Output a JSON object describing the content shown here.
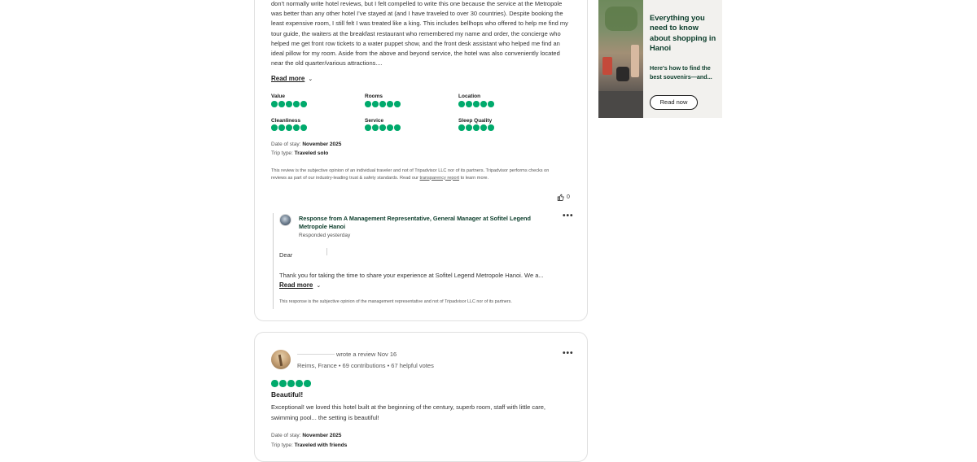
{
  "review1": {
    "body": "don’t normally write hotel reviews, but I felt compelled to write this one because the service at the Metropole was better than any other hotel I’ve stayed at (and I have traveled to over 30 countries). Despite booking the least expensive room, I still felt I was treated like a king. This includes bellhops who offered to help me find my tour guide, the waiters at the breakfast restaurant who remembered my name and order, the concierge who helped me get front row tickets to a water puppet show, and the front desk assistant who helped me find an ideal pillow for my room. Aside from the above and beyond service, the hotel was also conveniently located near the old quarter/various attractions....",
    "read_more": "Read more",
    "ratings": [
      {
        "label": "Value",
        "score": 5
      },
      {
        "label": "Rooms",
        "score": 5
      },
      {
        "label": "Location",
        "score": 5
      },
      {
        "label": "Cleanliness",
        "score": 5
      },
      {
        "label": "Service",
        "score": 5
      },
      {
        "label": "Sleep Quality",
        "score": 5
      }
    ],
    "date_label": "Date of stay:",
    "date_value": "November 2025",
    "trip_label": "Trip type:",
    "trip_value": "Traveled solo",
    "disclaimer_pre": "This review is the subjective opinion of an individual traveler and not of Tripadvisor LLC nor of its partners. Tripadvisor performs checks on reviews as part of our industry-leading trust & safety standards. Read our ",
    "disclaimer_link": "transparency report",
    "disclaimer_post": " to learn more.",
    "helpful_count": "0",
    "response": {
      "title": "Response from A Management Representative, General Manager at Sofitel Legend Metropole Hanoi",
      "subtitle": "Responded yesterday",
      "greeting": "Dear",
      "text": "Thank you for taking the time to share your experience at Sofitel Legend Metropole Hanoi. We a...",
      "read_more": "Read more",
      "disclaimer": "This response is the subjective opinion of the management representative and not of Tripadvisor LLC nor of its partners."
    }
  },
  "ad": {
    "title": "Everything you need to know about shopping in Hanoi",
    "subtitle": "Here's how to find the best souvenirs—and...",
    "button": "Read now"
  },
  "review2": {
    "wrote": "wrote a review Nov 16",
    "location": "Reims, France • 69 contributions • 67 helpful votes",
    "rating": 5,
    "title": "Beautiful!",
    "body": "Exceptional! we loved this hotel built at the beginning of the century, superb room, staff with little care, swimming pool... the setting is beautiful!",
    "date_label": "Date of stay:",
    "date_value": "November 2025",
    "trip_label": "Trip type:",
    "trip_value": "Traveled with friends"
  },
  "colors": {
    "bubble": "#00aa6c",
    "brand_dark": "#0b3d2b"
  }
}
